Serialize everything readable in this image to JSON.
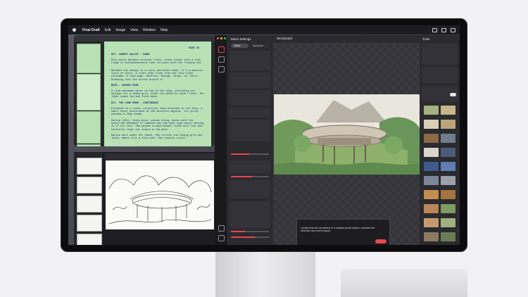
{
  "menubar": {
    "app_name": "Final Draft",
    "items": [
      "Edit",
      "Image",
      "View",
      "Window",
      "Help"
    ]
  },
  "final_draft": {
    "page_label": "PAGE 36",
    "scenes": [
      {
        "heading": "EXT. CANOPY VALLEY - DAWN",
        "body": "Mist pools between colossal trees. Vines loosen into a lush ridge of bioluminescence that collapse with the flowing sea."
      },
      {
        "heading": "",
        "body": "Beneath the canopy is a rusty aeolithic dome. It's a massive scale of shiny. A river that flows from the land finds nickname. A road edge. Recklest. Beings. Steps. On. Early. Breaking into the street around it."
      },
      {
        "heading": "MUIR - SWINGS RIDE",
        "body": "A slow shadowed minor on top of the ship, providing his shadows for a faded grid, under the metallic under fleet. The light comes low and fixes amid."
      },
      {
        "heading": "EXT. THE LOOK ROOM - CONTINUOUS",
        "body": "Elevated on a round, structural seam attached to the ship, a small hovel positioned at the moisture angular. Its porch, windows a deep shade."
      },
      {
        "heading": "",
        "body": "Dahlia (30s), sharp-eyed, stands along, moves with the unhurried movement of someone who has been high where nothing is of all this. She pauses a wood basket lined with root and carefully steps out toward a low path."
      },
      {
        "heading": "",
        "body": "Dahlia dark under her hands. She circles the fading grid and looks, makes into a slow hike. She expects a pull."
      }
    ]
  },
  "draw_things": {
    "settings_title": "Basic Settings",
    "settings_tabs": [
      "Basic",
      "Advanced"
    ],
    "canvas_selector": "Storyboard",
    "tools_title": "Tools",
    "prompt_text": "Convert the line-art sketch to a shaded pencil sketch, consider the structure and scene layout.",
    "generate_label": "Generate"
  },
  "colors": {
    "accent": "#e4474e",
    "script_page": "#b8e2b5",
    "script_ink": "#1d2a6b"
  }
}
